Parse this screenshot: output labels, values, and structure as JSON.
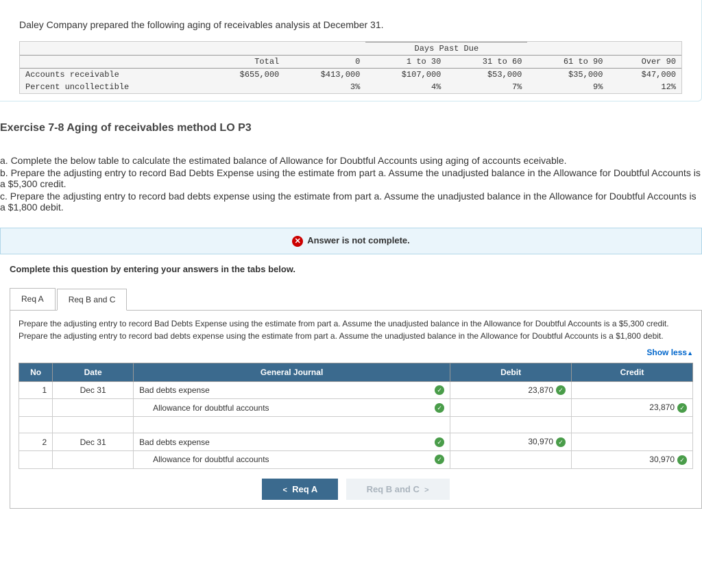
{
  "intro": "Daley Company prepared the following aging of receivables analysis at December 31.",
  "aging": {
    "megaheader": "Days Past Due",
    "cols": [
      "",
      "Total",
      "0",
      "1 to 30",
      "31 to 60",
      "61 to 90",
      "Over 90"
    ],
    "rows": [
      {
        "label": "Accounts receivable",
        "vals": [
          "$655,000",
          "$413,000",
          "$107,000",
          "$53,000",
          "$35,000",
          "$47,000"
        ]
      },
      {
        "label": "Percent uncollectible",
        "vals": [
          "",
          "3%",
          "4%",
          "7%",
          "9%",
          "12%"
        ]
      }
    ]
  },
  "exercise_title": "Exercise 7-8 Aging of receivables method LO P3",
  "instructions": {
    "a": "a. Complete the below table to calculate the estimated balance of Allowance for Doubtful Accounts using aging of accounts eceivable.",
    "b": "b. Prepare the adjusting entry to record Bad Debts Expense using the estimate from part a. Assume the unadjusted balance in the Allowance for Doubtful Accounts is a $5,300 credit.",
    "c": "c. Prepare the adjusting entry to record bad debts expense using the estimate from part a. Assume the unadjusted balance in the Allowance for Doubtful Accounts is a $1,800 debit."
  },
  "status_text": "Answer is not complete.",
  "complete_instr": "Complete this question by entering your answers in the tabs below.",
  "tabs": {
    "a": "Req A",
    "bc": "Req B and C"
  },
  "tab_text": {
    "p1": "Prepare the adjusting entry to record Bad Debts Expense using the estimate from part a. Assume the unadjusted balance in the Allowance for Doubtful Accounts is a $5,300 credit.",
    "p2": "Prepare the adjusting entry to record bad debts expense using the estimate from part a. Assume the unadjusted balance in the Allowance for Doubtful Accounts is a $1,800 debit."
  },
  "show_less": "Show less",
  "journal": {
    "headers": [
      "No",
      "Date",
      "General Journal",
      "Debit",
      "Credit"
    ],
    "entries": [
      {
        "no": "1",
        "date": "Dec 31",
        "lines": [
          {
            "account": "Bad debts expense",
            "debit": "23,870",
            "credit": ""
          },
          {
            "account": "Allowance for doubtful accounts",
            "debit": "",
            "credit": "23,870",
            "indent": true
          }
        ]
      },
      {
        "no": "2",
        "date": "Dec 31",
        "lines": [
          {
            "account": "Bad debts expense",
            "debit": "30,970",
            "credit": ""
          },
          {
            "account": "Allowance for doubtful accounts",
            "debit": "",
            "credit": "30,970",
            "indent": true
          }
        ]
      }
    ]
  },
  "nav": {
    "prev": "Req A",
    "next": "Req B and C"
  }
}
